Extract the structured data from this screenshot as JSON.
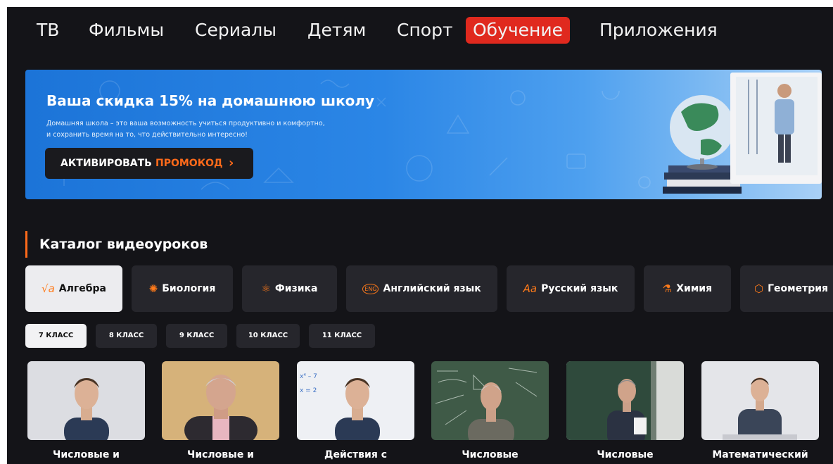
{
  "nav": {
    "items": [
      "ТВ",
      "Фильмы",
      "Сериалы",
      "Детям",
      "Спорт",
      "Обучение",
      "Приложения"
    ],
    "active": "Обучение"
  },
  "banner": {
    "title": "Ваша скидка 15% на домашнюю школу",
    "desc_line1": "Домашняя школа – это ваша возможность учиться продуктивно и комфортно,",
    "desc_line2": "и сохранить время на то, что действительно интересно!",
    "button_part1": "АКТИВИРОВАТЬ",
    "button_part2": "ПРОМОКОД",
    "button_chevron": "›"
  },
  "catalog": {
    "title": "Каталог видеоуроков",
    "subjects": [
      {
        "label": "Алгебра",
        "icon": "sqrt-icon",
        "glyph": "√a"
      },
      {
        "label": "Биология",
        "icon": "dna-icon",
        "glyph": "✺"
      },
      {
        "label": "Физика",
        "icon": "atom-icon",
        "glyph": "⚛"
      },
      {
        "label": "Английский язык",
        "icon": "eng-speech-icon",
        "glyph": "ENG"
      },
      {
        "label": "Русский язык",
        "icon": "aa-letters-icon",
        "glyph": "Aa"
      },
      {
        "label": "Химия",
        "icon": "flask-icon",
        "glyph": "⚗"
      },
      {
        "label": "Геометрия",
        "icon": "polygon-icon",
        "glyph": "⬡"
      }
    ],
    "grades": [
      "7 КЛАСС",
      "8 КЛАСС",
      "9 КЛАСС",
      "10 КЛАСС",
      "11 КЛАСС"
    ],
    "videos": [
      {
        "title": "Числовые и"
      },
      {
        "title": "Числовые и"
      },
      {
        "title": "Действия с",
        "board_text_1": "x⁴ – 7",
        "board_text_2": "x = 2"
      },
      {
        "title": "Числовые"
      },
      {
        "title": "Числовые"
      },
      {
        "title": "Математический"
      }
    ]
  },
  "colors": {
    "accent": "#e0291e",
    "orange": "#ff6a1a",
    "background": "#141418",
    "chip": "#26262c"
  }
}
